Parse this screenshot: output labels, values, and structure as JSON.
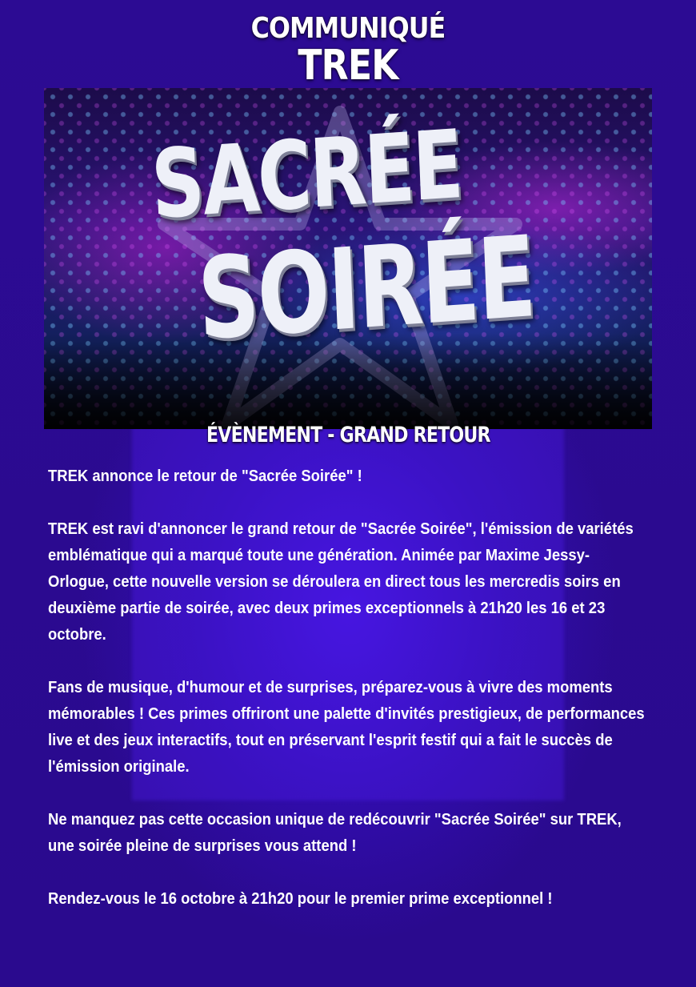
{
  "header": {
    "line1": "COMMUNIQUÉ",
    "line2": "TREK"
  },
  "banner": {
    "logo_line1": "SACRÉE",
    "logo_line2": "SOIRÉE"
  },
  "section_title": "ÉVÈNEMENT - GRAND RETOUR",
  "paragraphs": [
    "TREK annonce le retour de \"Sacrée Soirée\" !",
    "TREK est ravi d'annoncer le grand retour de \"Sacrée Soirée\", l'émission de variétés emblématique qui a marqué toute une génération. Animée par Maxime Jessy-Orlogue, cette nouvelle version se déroulera en direct tous les mercredis soirs en deuxième partie de soirée, avec deux primes exceptionnels à 21h20 les 16 et 23 octobre.",
    "Fans de musique, d'humour et de surprises, préparez-vous à vivre des moments mémorables ! Ces primes offriront une palette d'invités prestigieux, de performances live et des jeux interactifs, tout en préservant l'esprit festif qui a fait le succès de l'émission originale.",
    "Ne manquez pas cette occasion unique de redécouvrir \"Sacrée Soirée\" sur TREK, une soirée pleine de surprises vous attend !",
    "Rendez-vous le 16 octobre à 21h20 pour le premier prime exceptionnel !"
  ],
  "colors": {
    "background": "#2a0a8e",
    "text": "#ffffff"
  }
}
